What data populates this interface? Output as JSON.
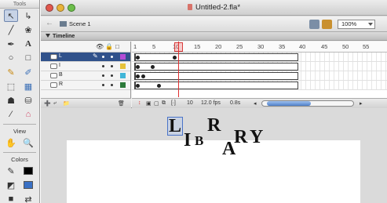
{
  "tools_panel": {
    "title": "Tools",
    "sections": {
      "view": "View",
      "colors": "Colors"
    }
  },
  "window": {
    "title": "Untitled-2.fla*"
  },
  "edit_bar": {
    "scene": "Scene 1",
    "zoom": "100%"
  },
  "timeline": {
    "label": "Timeline",
    "ruler": [
      "1",
      "5",
      "10",
      "15",
      "20",
      "25",
      "30",
      "35",
      "40",
      "45",
      "50",
      "55"
    ],
    "layers": [
      {
        "name": "L",
        "selected": true,
        "color": "#b44cd6"
      },
      {
        "name": "I",
        "selected": false,
        "color": "#e6c23b"
      },
      {
        "name": "B",
        "selected": false,
        "color": "#41b6d8"
      },
      {
        "name": "R",
        "selected": false,
        "color": "#2c7a3a"
      }
    ],
    "status": {
      "frame": "10",
      "fps": "12.0 fps",
      "time": "0.8s"
    }
  },
  "stage": {
    "letters": [
      {
        "char": "L",
        "size": "big"
      },
      {
        "char": "I",
        "size": "big"
      },
      {
        "char": "B",
        "size": "small"
      },
      {
        "char": "R",
        "size": "big"
      },
      {
        "char": "A",
        "size": "big"
      },
      {
        "char": "R",
        "size": "big"
      },
      {
        "char": "Y",
        "size": "big"
      }
    ]
  }
}
